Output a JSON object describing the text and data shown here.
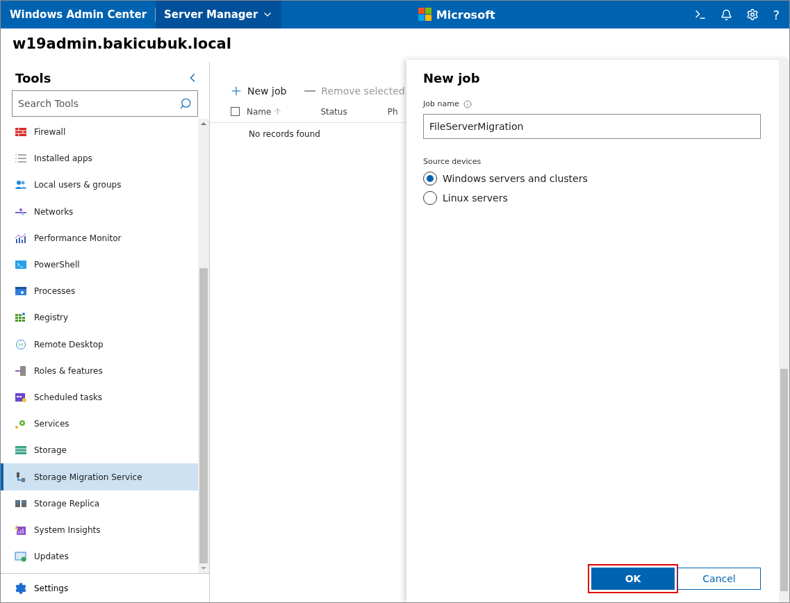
{
  "top_bar": {
    "brand": "Windows Admin Center",
    "tool_menu": "Server Manager",
    "vendor": "Microsoft",
    "help": "?"
  },
  "server_name": "w19admin.bakicubuk.local",
  "sidebar": {
    "title": "Tools",
    "search": {
      "placeholder": "Search Tools"
    },
    "items": [
      {
        "label": "Firewall",
        "selected": false
      },
      {
        "label": "Installed apps",
        "selected": false
      },
      {
        "label": "Local users & groups",
        "selected": false
      },
      {
        "label": "Networks",
        "selected": false
      },
      {
        "label": "Performance Monitor",
        "selected": false
      },
      {
        "label": "PowerShell",
        "selected": false
      },
      {
        "label": "Processes",
        "selected": false
      },
      {
        "label": "Registry",
        "selected": false
      },
      {
        "label": "Remote Desktop",
        "selected": false
      },
      {
        "label": "Roles & features",
        "selected": false
      },
      {
        "label": "Scheduled tasks",
        "selected": false
      },
      {
        "label": "Services",
        "selected": false
      },
      {
        "label": "Storage",
        "selected": false
      },
      {
        "label": "Storage Migration Service",
        "selected": true
      },
      {
        "label": "Storage Replica",
        "selected": false
      },
      {
        "label": "System Insights",
        "selected": false
      },
      {
        "label": "Updates",
        "selected": false
      }
    ],
    "settings": "Settings"
  },
  "toolbar": [
    {
      "label": "New job",
      "kind": "add",
      "disabled": false
    },
    {
      "label": "Remove selected",
      "kind": "remove",
      "disabled": true
    }
  ],
  "table": {
    "select_all": {
      "checked": false
    },
    "columns": [
      {
        "label": "Name",
        "sorted": true
      },
      {
        "label": "Status"
      },
      {
        "label": "Ph"
      }
    ],
    "empty_message": "No records found"
  },
  "panel": {
    "title": "New job",
    "job_name": {
      "label": "Job name",
      "value": "FileServerMigration"
    },
    "source_devices": {
      "label": "Source devices",
      "options": [
        {
          "label": "Windows servers and clusters",
          "selected": true
        },
        {
          "label": "Linux servers",
          "selected": false
        }
      ]
    },
    "buttons": [
      {
        "label": "OK",
        "kind": "primary",
        "highlighted": true
      },
      {
        "label": "Cancel",
        "kind": "secondary",
        "highlighted": false
      }
    ]
  }
}
